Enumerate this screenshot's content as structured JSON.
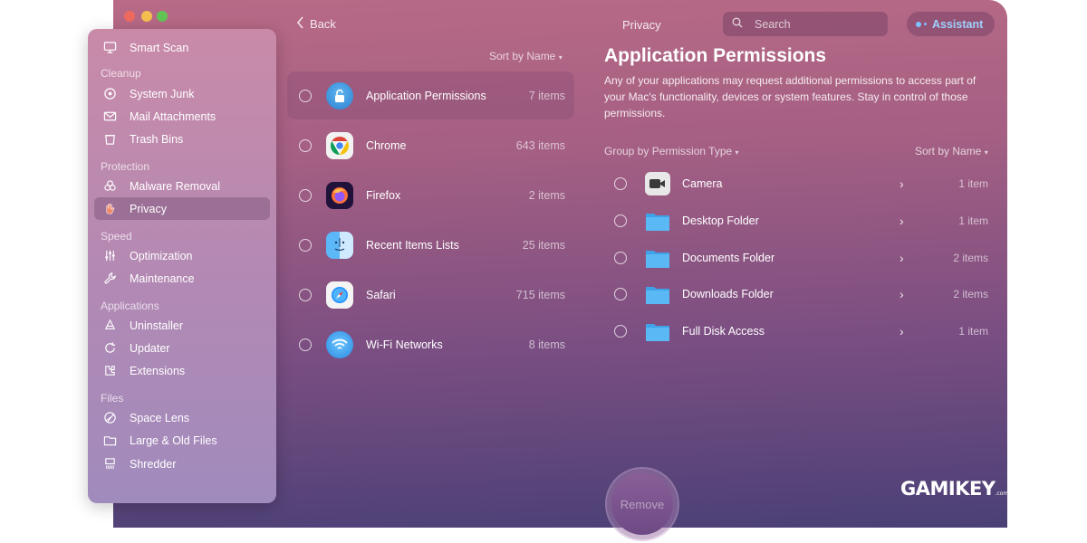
{
  "sidebar": {
    "top_item": {
      "label": "Smart Scan",
      "icon": "monitor-icon"
    },
    "sections": [
      {
        "title": "Cleanup",
        "items": [
          {
            "label": "System Junk",
            "icon": "disk-icon"
          },
          {
            "label": "Mail Attachments",
            "icon": "envelope-icon"
          },
          {
            "label": "Trash Bins",
            "icon": "trash-icon"
          }
        ]
      },
      {
        "title": "Protection",
        "items": [
          {
            "label": "Malware Removal",
            "icon": "biohazard-icon"
          },
          {
            "label": "Privacy",
            "icon": "hand-icon"
          }
        ]
      },
      {
        "title": "Speed",
        "items": [
          {
            "label": "Optimization",
            "icon": "sliders-icon"
          },
          {
            "label": "Maintenance",
            "icon": "wrench-icon"
          }
        ]
      },
      {
        "title": "Applications",
        "items": [
          {
            "label": "Uninstaller",
            "icon": "apps-icon"
          },
          {
            "label": "Updater",
            "icon": "update-icon"
          },
          {
            "label": "Extensions",
            "icon": "extensions-icon"
          }
        ]
      },
      {
        "title": "Files",
        "items": [
          {
            "label": "Space Lens",
            "icon": "lens-icon"
          },
          {
            "label": "Large & Old Files",
            "icon": "folder-icon"
          },
          {
            "label": "Shredder",
            "icon": "shredder-icon"
          }
        ]
      }
    ],
    "active": "Privacy"
  },
  "topbar": {
    "back_label": "Back",
    "title": "Privacy",
    "search_placeholder": "Search",
    "assistant_label": "Assistant"
  },
  "apps": {
    "sort_label": "Sort by Name",
    "items": [
      {
        "name": "Application Permissions",
        "count": "7 items",
        "icon": "lock-icon",
        "selected": true
      },
      {
        "name": "Chrome",
        "count": "643 items",
        "icon": "chrome-icon"
      },
      {
        "name": "Firefox",
        "count": "2 items",
        "icon": "firefox-icon"
      },
      {
        "name": "Recent Items Lists",
        "count": "25 items",
        "icon": "finder-icon"
      },
      {
        "name": "Safari",
        "count": "715 items",
        "icon": "safari-icon"
      },
      {
        "name": "Wi-Fi Networks",
        "count": "8 items",
        "icon": "wifi-icon"
      }
    ]
  },
  "details": {
    "title": "Application Permissions",
    "description": "Any of your applications may request additional permissions to access part of your Mac's functionality, devices or system features. Stay in control of those permissions.",
    "group_label": "Group by Permission Type",
    "sort_label": "Sort by Name",
    "items": [
      {
        "name": "Camera",
        "count": "1 item",
        "icon": "camera-icon"
      },
      {
        "name": "Desktop Folder",
        "count": "1 item",
        "icon": "folder-icon"
      },
      {
        "name": "Documents Folder",
        "count": "2 items",
        "icon": "folder-icon"
      },
      {
        "name": "Downloads Folder",
        "count": "2 items",
        "icon": "folder-icon"
      },
      {
        "name": "Full Disk Access",
        "count": "1 item",
        "icon": "folder-icon"
      }
    ]
  },
  "remove_label": "Remove",
  "watermark": {
    "text": "GAMIKEY",
    "suffix": ".com"
  },
  "colors": {
    "accent": "#7fc0ff",
    "window_top": "#b86a86",
    "window_bottom": "#4a4076"
  }
}
